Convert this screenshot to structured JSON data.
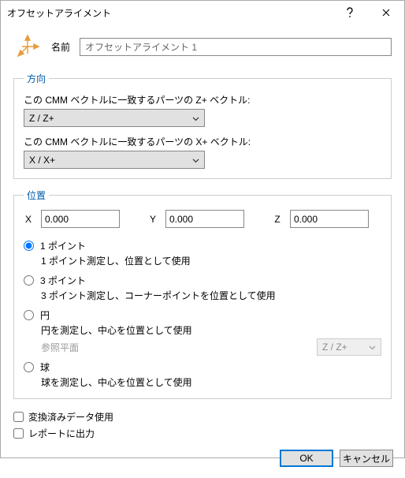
{
  "window": {
    "title": "オフセットアライメント"
  },
  "name_row": {
    "label": "名前",
    "value": "オフセットアライメント 1"
  },
  "direction": {
    "legend": "方向",
    "z_label": "この CMM ベクトルに一致するパーツの Z+ ベクトル:",
    "z_value": "Z / Z+",
    "x_label": "この CMM ベクトルに一致するパーツの X+ ベクトル:",
    "x_value": "X / X+"
  },
  "position": {
    "legend": "位置",
    "x_label": "X",
    "x_value": "0.000",
    "y_label": "Y",
    "y_value": "0.000",
    "z_label": "Z",
    "z_value": "0.000",
    "options": {
      "p1": {
        "label": "1 ポイント",
        "desc": "1 ポイント測定し、位置として使用"
      },
      "p3": {
        "label": "3 ポイント",
        "desc": "3 ポイント測定し、コーナーポイントを位置として使用"
      },
      "circ": {
        "label": "円",
        "desc": "円を測定し、中心を位置として使用",
        "ref_label": "参照平面",
        "ref_value": "Z / Z+"
      },
      "sph": {
        "label": "球",
        "desc": "球を測定し、中心を位置として使用"
      }
    },
    "selected": "p1"
  },
  "checks": {
    "use_converted": "変換済みデータ使用",
    "to_report": "レポートに出力"
  },
  "buttons": {
    "ok": "OK",
    "cancel": "キャンセル"
  }
}
